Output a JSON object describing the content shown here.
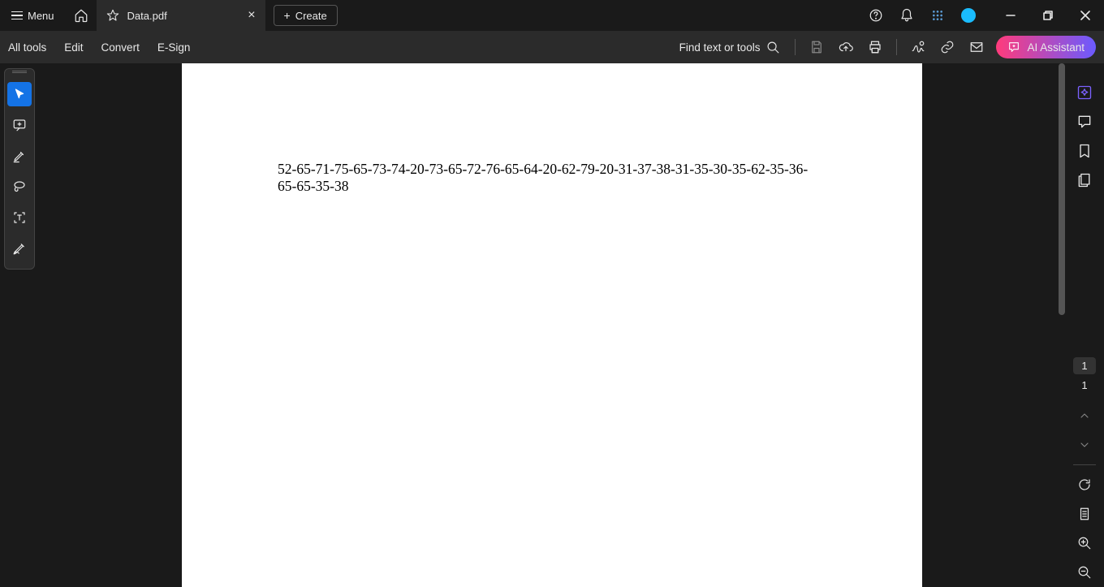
{
  "titleBar": {
    "menuLabel": "Menu",
    "tabTitle": "Data.pdf",
    "createLabel": "Create"
  },
  "toolBar": {
    "items": [
      "All tools",
      "Edit",
      "Convert",
      "E-Sign"
    ],
    "findLabel": "Find text or tools",
    "aiLabel": "AI Assistant"
  },
  "document": {
    "text": "52-65-71-75-65-73-74-20-73-65-72-76-65-64-20-62-79-20-31-37-38-31-35-30-35-62-35-36-65-65-35-38"
  },
  "pageNav": {
    "current": "1",
    "total": "1"
  }
}
